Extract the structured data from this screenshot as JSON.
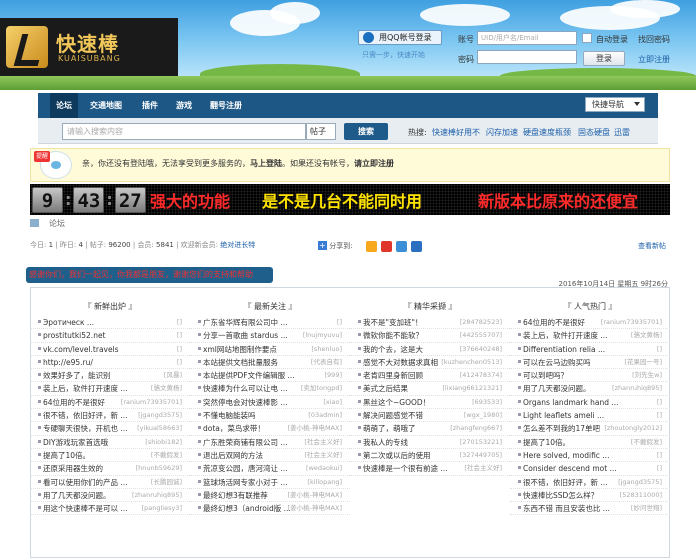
{
  "brand": {
    "name_cn": "快速棒",
    "name_en": "KUAISUBANG"
  },
  "login": {
    "qq_button": "用QQ帐号登录",
    "qq_sub": "只需一步，快速开始",
    "account_label": "账号",
    "account_placeholder": "UID/用户名/Email",
    "auto_login": "自动登录",
    "forgot": "找回密码",
    "password_label": "密码",
    "login_button": "登录",
    "register": "立即注册"
  },
  "nav": {
    "items": [
      "论坛",
      "交通地图",
      "插件",
      "游戏",
      "翻号注册"
    ],
    "quick_nav": "快捷导航"
  },
  "search": {
    "placeholder": "请输入搜索内容",
    "type": "帖子",
    "button": "搜索",
    "hot_label": "热搜:",
    "hot": [
      "快速棒好用不",
      "闪存加速",
      "硬盘速度瓶颈",
      "固态硬盘",
      "迅雷"
    ]
  },
  "notice": {
    "badge": "提醒",
    "text_1": "亲，你还没有登陆哦，无法享受到更多服务的，",
    "login_link": "马上登陆",
    "text_2": "。如果还没有帐号，",
    "register_link": "请立即注册"
  },
  "banner": {
    "clock": [
      "9",
      "43",
      "27"
    ],
    "text_1": "强大的功能",
    "text_2": "是不是几台不能同时用",
    "text_3": "新版本比原来的还便宜"
  },
  "breadcrumb": "论坛",
  "stats": {
    "today_label": "今日:",
    "today": "1",
    "yesterday_label": "昨日:",
    "yesterday": "4",
    "posts_label": "帖子:",
    "posts": "96200",
    "members_label": "会员:",
    "members": "5841",
    "welcome": "欢迎新会员:",
    "new_member": "绝对进长特"
  },
  "share_label": "分享到:",
  "newest_link": "查看新帖",
  "marquee": "感谢你们，我们一起见，你我都是朋友，谢谢您们的支持和帮助",
  "date": "2016年10月14日 星期五 9时26分",
  "columns": [
    {
      "title": "『 新鲜出炉 』",
      "rows": [
        {
          "t": "Эротическ ...",
          "a": "[]"
        },
        {
          "t": "prostitutki52.net",
          "a": "[]"
        },
        {
          "t": "vk.com/level.travels",
          "a": "[]"
        },
        {
          "t": "http://e95.ru/",
          "a": "[]"
        },
        {
          "t": "效果好多了，能识别",
          "a": "[风暴]"
        },
        {
          "t": "装上后，软件打开速度 ...",
          "a": "[骆文黄杨]"
        },
        {
          "t": "64位用的不是很好",
          "a": "[ranium73935701]"
        },
        {
          "t": "很不错，依旧好评，新 ...",
          "a": "[jgangd3575]"
        },
        {
          "t": "专硬聊天很快，开机也 ...",
          "a": "[yikual58663]"
        },
        {
          "t": "DIY游戏玩家首选哦",
          "a": "[shiobi182]"
        },
        {
          "t": "提高了10倍。",
          "a": "[不戴假发]"
        },
        {
          "t": "还原采用器生效的",
          "a": "[hnunb59629]"
        },
        {
          "t": "看可以使用你们的产品 ...",
          "a": "[长鹏园诚]"
        },
        {
          "t": "用了几天都没问题。",
          "a": "[zhanruhiq895]"
        },
        {
          "t": "用这个快速棒不是可以 ...",
          "a": "[pangliesy3]"
        }
      ]
    },
    {
      "title": "『 最新关注 』",
      "rows": [
        {
          "t": "广东省华辉有限公司中 ...",
          "a": "[]"
        },
        {
          "t": "分享一首歌曲 stardus ...",
          "a": "[lnujmyuvu]"
        },
        {
          "t": "xml网站地图制作要点",
          "a": "[shenluo]"
        },
        {
          "t": "本站提供文档批量服务",
          "a": "[代表自有]"
        },
        {
          "t": "本站提供PDF文件编辑服 ...",
          "a": "[999]"
        },
        {
          "t": "快速棒为什么可以让电 ...",
          "a": "[卖加tongpd]"
        },
        {
          "t": "突然停电会对快速棒影 ...",
          "a": "[xiao]"
        },
        {
          "t": "不懂电脑能装吗",
          "a": "[03admin]"
        },
        {
          "t": "dota，菜鸟求带！",
          "a": "[姜小桃-神电MAX]"
        },
        {
          "t": "广东胜荣商铺有限公司 ...",
          "a": "[社会主义好]"
        },
        {
          "t": "退出后双网的方法",
          "a": "[社会主义好]"
        },
        {
          "t": "荒凉变公园，唐河湾让 ...",
          "a": "[wedaokui]"
        },
        {
          "t": "篮球场活网专家小对于 ...",
          "a": "[killopang]"
        },
        {
          "t": "最终幻想3有联推荐",
          "a": "[姜小桃-神电MAX]"
        },
        {
          "t": "最终幻想3（android版 ...",
          "a": "[姜小桃-神电MAX]"
        }
      ]
    },
    {
      "title": "『 精华采撷 』",
      "rows": [
        {
          "t": "我不是\"变加班\"！",
          "a": "[284782523]"
        },
        {
          "t": "微软你能不能软？",
          "a": "[442555707]"
        },
        {
          "t": "我的个去，这是大",
          "a": "[376640248]"
        },
        {
          "t": "感觉不大对数据求真相",
          "a": "[kuzhenchen0513]"
        },
        {
          "t": "老肯四里身新回顾",
          "a": "[412478374]"
        },
        {
          "t": "美式之后结果",
          "a": "[lixiang66121321]"
        },
        {
          "t": "黑丝这个~GOOD！",
          "a": "[693533]"
        },
        {
          "t": "解决问题感觉不错",
          "a": "[wgx_1980]"
        },
        {
          "t": "萌萌了，萌哦了",
          "a": "[zhangfeng667]"
        },
        {
          "t": "我私人的专线",
          "a": "[270153221]"
        },
        {
          "t": "第二次或以后的使用",
          "a": "[327449705]"
        },
        {
          "t": "快速棒是一个很有前途 ...",
          "a": "[社会主义好]"
        }
      ]
    },
    {
      "title": "『 人气热门 』",
      "rows": [
        {
          "t": "64位用的不是很好",
          "a": "[ranium73935701]"
        },
        {
          "t": "装上后，软件打开速度 ...",
          "a": "[骆文黄杨]"
        },
        {
          "t": "Differentiation relia ...",
          "a": "[]"
        },
        {
          "t": "可以在云马边购买吗",
          "a": "[花果园一号]"
        },
        {
          "t": "可以到吧吗？",
          "a": "[刘先生w]"
        },
        {
          "t": "用了几天都没问题。",
          "a": "[zhanruhiq895]"
        },
        {
          "t": "Organs landmark hand ...",
          "a": "[]"
        },
        {
          "t": "Light leaflets ameli ...",
          "a": "[]"
        },
        {
          "t": "怎么差不到我的17单吧",
          "a": "[zhoutongly2012]"
        },
        {
          "t": "提高了10倍。",
          "a": "[不戴假发]"
        },
        {
          "t": "Here solved, modific ...",
          "a": "[]"
        },
        {
          "t": "Consider descend mot ...",
          "a": "[]"
        },
        {
          "t": "很不错，依旧好评，新 ...",
          "a": "[jgangd3575]"
        },
        {
          "t": "快速棒比SSD怎么样？",
          "a": "[528311000]"
        },
        {
          "t": "东西不错 而且安装也比 ...",
          "a": "[妙问世翔]"
        }
      ]
    }
  ],
  "colors": {
    "nav": "#1d5786",
    "notice_bg": "#fffbd9",
    "banner_red": "#ff2a2a",
    "banner_yellow": "#ffe300",
    "link": "#1b5ea8"
  }
}
